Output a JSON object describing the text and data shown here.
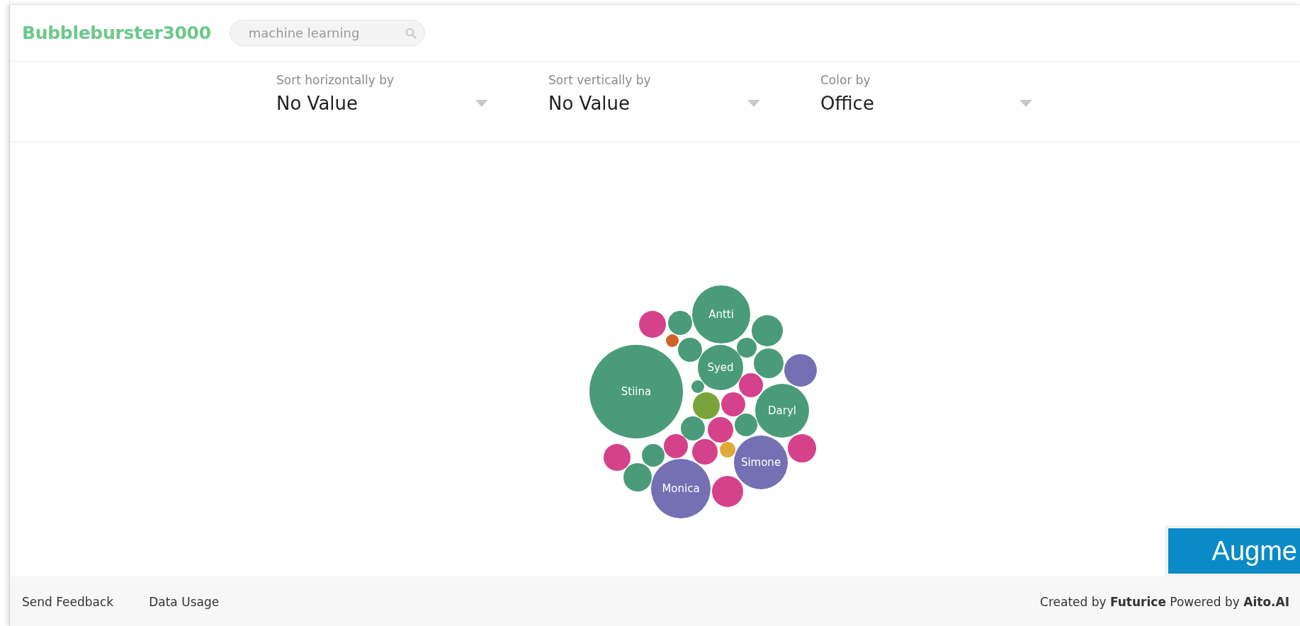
{
  "header": {
    "title": "Bubbleburster3000",
    "search": {
      "placeholder": "machine learning"
    }
  },
  "filters": [
    {
      "label": "Sort horizontally by",
      "value": "No Value"
    },
    {
      "label": "Sort vertically by",
      "value": "No Value"
    },
    {
      "label": "Color by",
      "value": "Office"
    }
  ],
  "bubbles": [
    {
      "label": "Stiina",
      "color": "#4a9b7a"
    },
    {
      "label": "Antti",
      "color": "#4a9b7a"
    },
    {
      "label": "Syed",
      "color": "#4a9b7a"
    },
    {
      "label": "Daryl",
      "color": "#4a9b7a"
    },
    {
      "label": "Simone",
      "color": "#7570b3"
    },
    {
      "label": "Monica",
      "color": "#7570b3"
    },
    {
      "color": "#d6418b"
    },
    {
      "color": "#4a9b7a"
    },
    {
      "color": "#d0632a"
    },
    {
      "color": "#4a9b7a"
    },
    {
      "color": "#4a9b7a"
    },
    {
      "color": "#4a9b7a"
    },
    {
      "color": "#4a9b7a"
    },
    {
      "color": "#7570b3"
    },
    {
      "color": "#4a9b7a"
    },
    {
      "color": "#d6418b"
    },
    {
      "color": "#7aa33a"
    },
    {
      "color": "#d6418b"
    },
    {
      "color": "#4a9b7a"
    },
    {
      "color": "#d6418b"
    },
    {
      "color": "#4a9b7a"
    },
    {
      "color": "#d6418b"
    },
    {
      "color": "#d6418b"
    },
    {
      "color": "#dfaa3a"
    },
    {
      "color": "#d6418b"
    },
    {
      "color": "#d6418b"
    },
    {
      "color": "#4a9b7a"
    },
    {
      "color": "#4a9b7a"
    },
    {
      "color": "#d6418b"
    }
  ],
  "floating_button": {
    "label": "Augme"
  },
  "footer": {
    "links": [
      "Send Feedback",
      "Data Usage"
    ],
    "credits": "Created by **Futurice** Powered by **Aito.AI**"
  }
}
